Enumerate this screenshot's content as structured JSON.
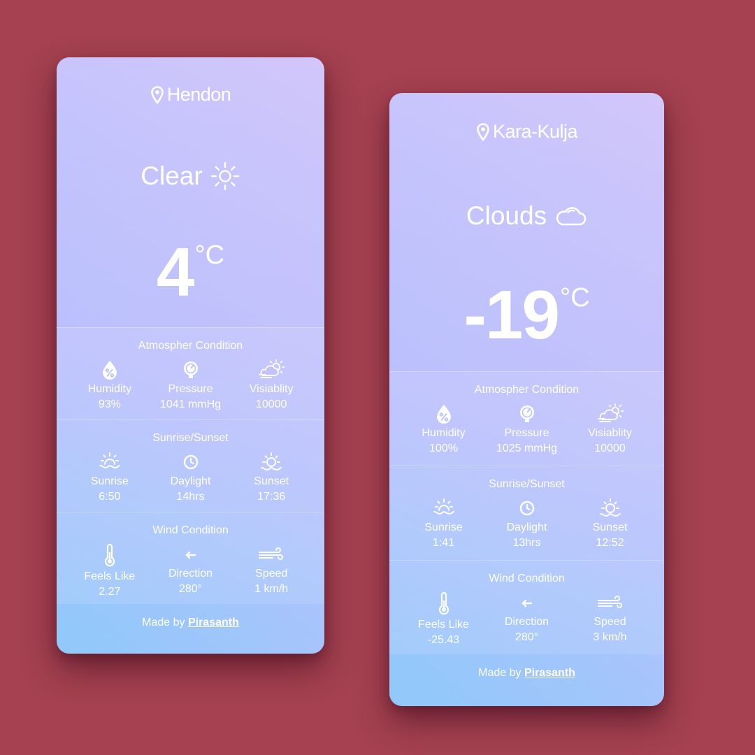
{
  "cards": [
    {
      "location": "Hendon",
      "condition": "Clear",
      "condition_icon": "sun-icon",
      "temp": "4",
      "unit": "°C",
      "atmosphere": {
        "title": "Atmospher Condition",
        "humidity_label": "Humidity",
        "humidity": "93%",
        "pressure_label": "Pressure",
        "pressure": "1041 mmHg",
        "visibility_label": "Visiablity",
        "visibility": "10000"
      },
      "sun": {
        "title": "Sunrise/Sunset",
        "sunrise_label": "Sunrise",
        "sunrise": "6:50",
        "daylight_label": "Daylight",
        "daylight": "14hrs",
        "sunset_label": "Sunset",
        "sunset": "17:36"
      },
      "wind": {
        "title": "Wind Condition",
        "feels_label": "Feels Like",
        "feels": "2.27",
        "direction_label": "Direction",
        "direction": "280°",
        "speed_label": "Speed",
        "speed": "1 km/h"
      },
      "footer": {
        "prefix": "Made by",
        "author": "Pirasanth"
      }
    },
    {
      "location": "Kara-Kulja",
      "condition": "Clouds",
      "condition_icon": "cloud-icon",
      "temp": "-19",
      "unit": "°C",
      "atmosphere": {
        "title": "Atmospher Condition",
        "humidity_label": "Humidity",
        "humidity": "100%",
        "pressure_label": "Pressure",
        "pressure": "1025 mmHg",
        "visibility_label": "Visiablity",
        "visibility": "10000"
      },
      "sun": {
        "title": "Sunrise/Sunset",
        "sunrise_label": "Sunrise",
        "sunrise": "1:41",
        "daylight_label": "Daylight",
        "daylight": "13hrs",
        "sunset_label": "Sunset",
        "sunset": "12:52"
      },
      "wind": {
        "title": "Wind Condition",
        "feels_label": "Feels Like",
        "feels": "-25.43",
        "direction_label": "Direction",
        "direction": "280°",
        "speed_label": "Speed",
        "speed": "3 km/h"
      },
      "footer": {
        "prefix": "Made by",
        "author": "Pirasanth"
      }
    }
  ],
  "colors": {
    "background": "#a54151",
    "text": "#ffffff",
    "card_top": "#c4c2fa",
    "card_bottom": "#8cc8fa"
  }
}
